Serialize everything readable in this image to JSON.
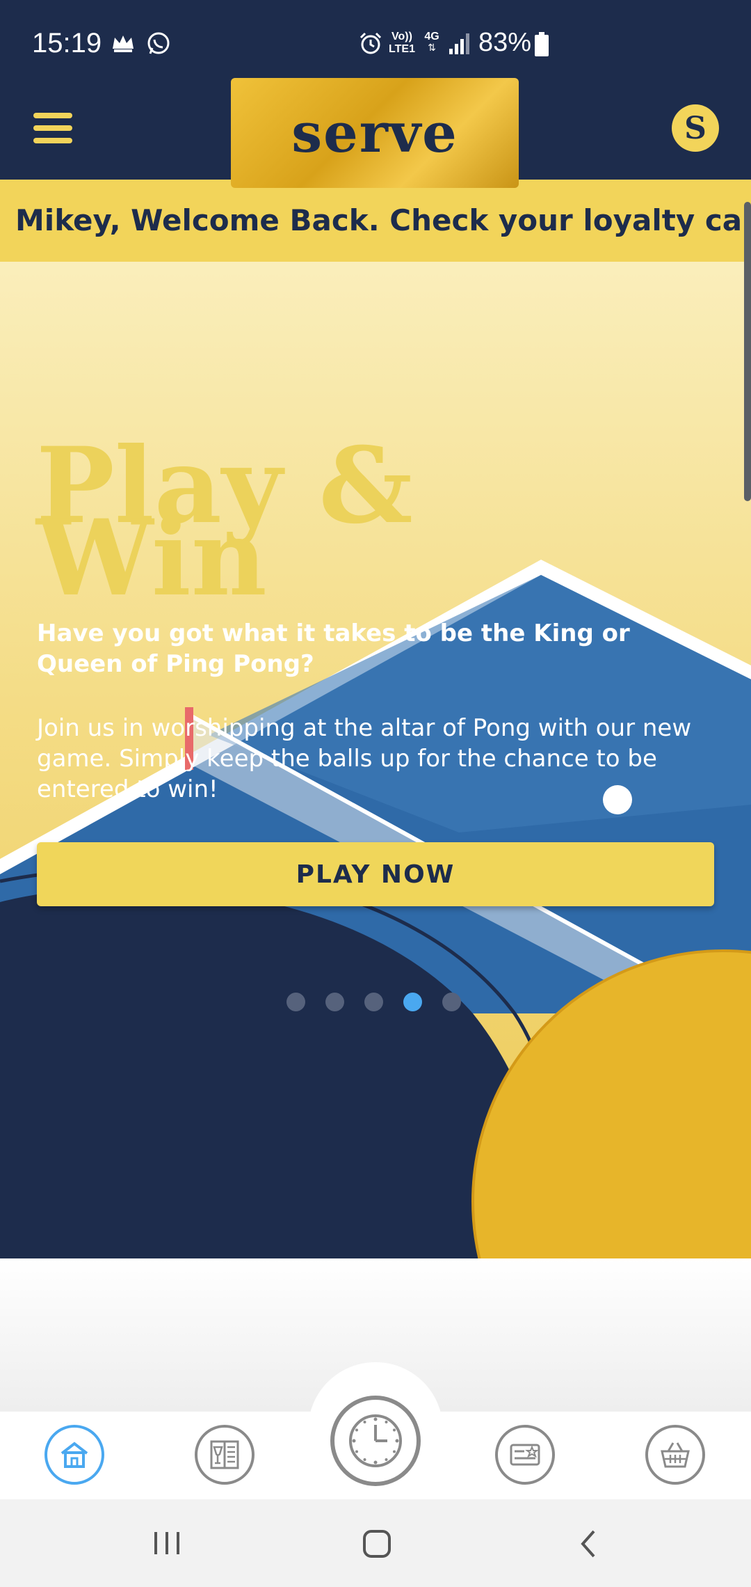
{
  "status_bar": {
    "time": "15:19",
    "battery_percent": "83%",
    "network_type": "4G",
    "volte_label_top": "Vo))",
    "volte_label_bottom": "LTE1",
    "icons": [
      "crown-icon",
      "whatsapp-icon",
      "alarm-icon",
      "volte-icon",
      "network-4g-icon",
      "signal-icon",
      "battery-icon"
    ]
  },
  "header": {
    "logo_text": "serve",
    "menu_icon": "hamburger-menu-icon",
    "account_icon": "serve-badge-icon"
  },
  "ticker": {
    "text": "Mikey, Welcome Back. Check your loyalty card for t"
  },
  "hero": {
    "title_line1": "Play &",
    "title_line2": "Win",
    "subtitle": "Have you got what it takes to be the King or Queen of Ping Pong?",
    "body": "Join us in worshipping at the altar of Pong with our new game. Simply keep the balls up for the chance to be entered to win!",
    "cta_label": "PLAY NOW",
    "carousel": {
      "total_slides": 5,
      "active_index": 3
    }
  },
  "bottom_tabs": [
    {
      "icon": "home-icon",
      "active": true
    },
    {
      "icon": "drinks-menu-icon",
      "active": false
    },
    {
      "icon": "clock-icon",
      "active": false
    },
    {
      "icon": "loyalty-card-icon",
      "active": false
    },
    {
      "icon": "basket-icon",
      "active": false
    }
  ],
  "colors": {
    "navy": "#1d2c4c",
    "yellow": "#f2d45a",
    "accent_blue": "#4aa8f0",
    "gold": "#d8a21a"
  }
}
